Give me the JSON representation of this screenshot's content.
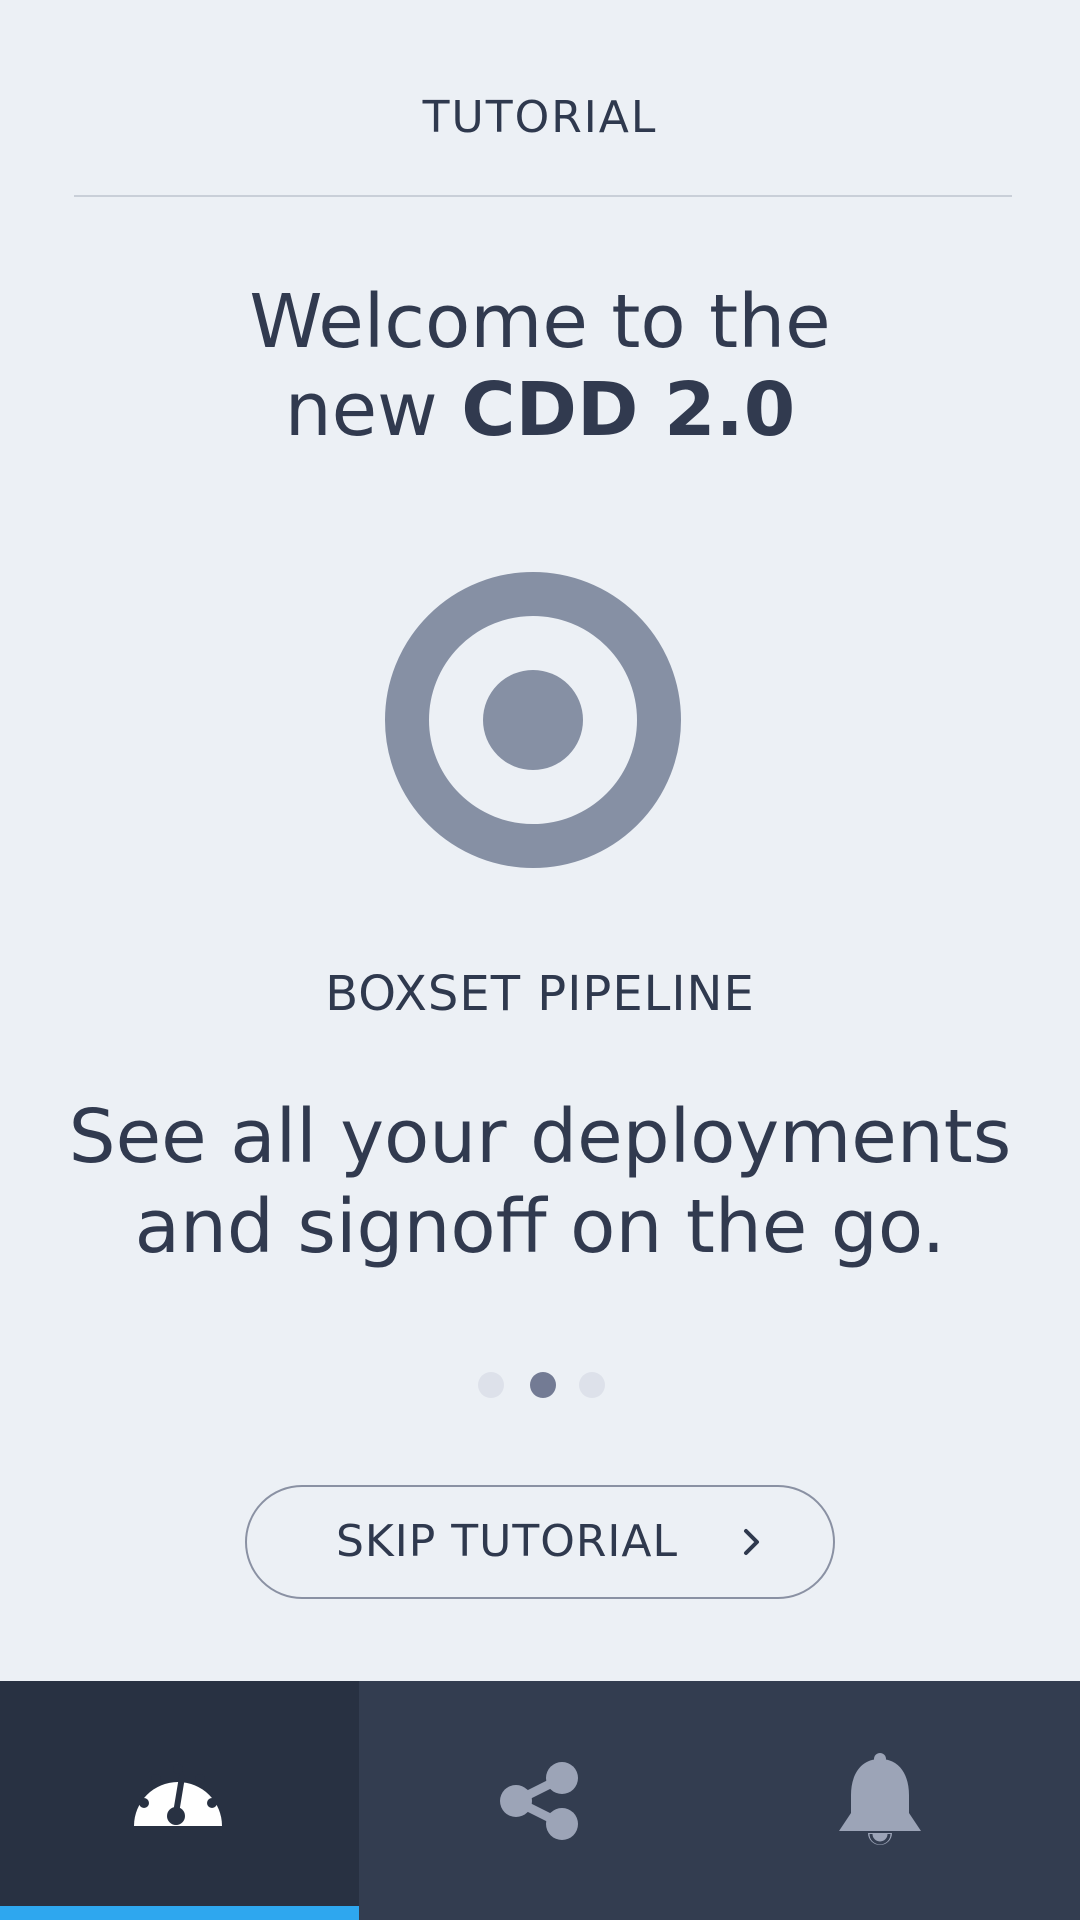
{
  "header": {
    "title": "TUTORIAL"
  },
  "welcome": {
    "line1": "Welcome to the",
    "line2_prefix": "new ",
    "line2_strong": "CDD 2.0"
  },
  "slide": {
    "icon": "target-icon",
    "title": "BOXSET PIPELINE",
    "description_line1": "See all your deployments",
    "description_line2": "and signoff on the go."
  },
  "pager": {
    "total": 3,
    "active_index": 1
  },
  "skip_button": {
    "label": "SKIP TUTORIAL",
    "icon": "chevron-right-icon"
  },
  "tabbar": {
    "tabs": [
      {
        "icon": "dashboard-gauge-icon",
        "active": true
      },
      {
        "icon": "share-icon",
        "active": false
      },
      {
        "icon": "bell-icon",
        "active": false
      }
    ]
  },
  "colors": {
    "background": "#ecf0f5",
    "text": "#313a4f",
    "icon_gray": "#8690a4",
    "tabbar": "#333d50",
    "tab_active": "#283142",
    "tab_indicator": "#2ea7ef",
    "dot_active": "#737b94",
    "dot_inactive": "#dde1ea"
  }
}
